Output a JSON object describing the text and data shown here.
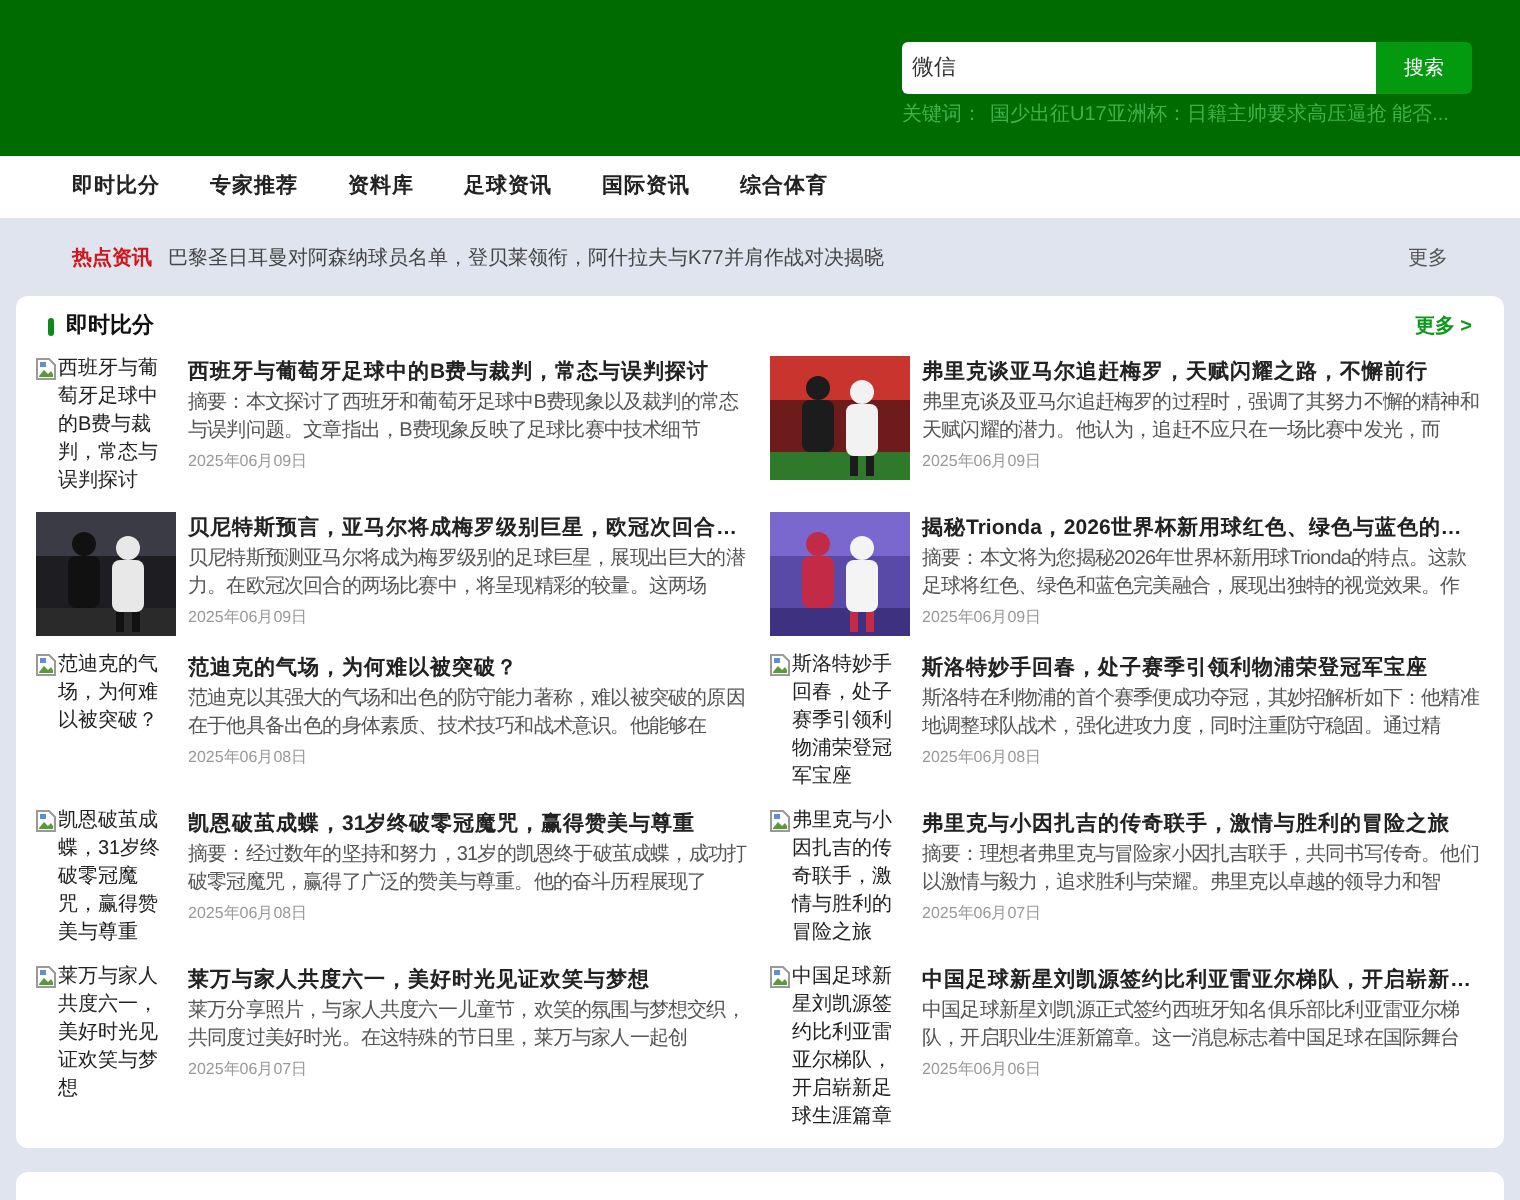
{
  "search": {
    "value": "微信",
    "button": "搜索"
  },
  "keywords": {
    "label": "关键词：",
    "text": "国少出征U17亚洲杯：日籍主帅要求高压逼抢  能否..."
  },
  "nav": [
    "即时比分",
    "专家推荐",
    "资料库",
    "足球资讯",
    "国际资讯",
    "综合体育"
  ],
  "hot_news": {
    "label": "热点资讯",
    "headline": "巴黎圣日耳曼对阿森纳球员名单，登贝莱领衔，阿什拉夫与K77并肩作战对决揭晓",
    "more": "更多"
  },
  "section": {
    "title": "即时比分",
    "more": "更多 >",
    "articles": [
      {
        "kind": "broken",
        "image_alt": "西班牙与葡萄牙足球中的B费与裁判，常态与误判探讨",
        "title": "西班牙与葡萄牙足球中的B费与裁判，常态与误判探讨",
        "summary": "摘要：本文探讨了西班牙和葡萄牙足球中B费现象以及裁判的常态与误判问题。文章指出，B费现象反映了足球比赛中技术细节",
        "date": "2025年06月09日"
      },
      {
        "title": "弗里克谈亚马尔追赶梅罗，天赋闪耀之路，不懈前行",
        "summary": "弗里克谈及亚马尔追赶梅罗的过程时，强调了其努力不懈的精神和天赋闪耀的潜力。他认为，追赶不应只在一场比赛中发光，而",
        "date": "2025年06月09日"
      },
      {
        "title": "贝尼特斯预言，亚马尔将成梅罗级别巨星，欧冠次回合…",
        "summary": "贝尼特斯预测亚马尔将成为梅罗级别的足球巨星，展现出巨大的潜力。在欧冠次回合的两场比赛中，将呈现精彩的较量。这两场",
        "date": "2025年06月09日"
      },
      {
        "title": "揭秘Trionda，2026世界杯新用球红色、绿色与蓝色的…",
        "summary": "摘要：本文将为您揭秘2026年世界杯新用球Trionda的特点。这款足球将红色、绿色和蓝色完美融合，展现出独特的视觉效果。作",
        "date": "2025年06月09日"
      },
      {
        "kind": "broken",
        "image_alt": "范迪克的气场，为何难以被突破？",
        "title": "范迪克的气场，为何难以被突破？",
        "summary": "范迪克以其强大的气场和出色的防守能力著称，难以被突破的原因在于他具备出色的身体素质、技术技巧和战术意识。他能够在",
        "date": "2025年06月08日"
      },
      {
        "kind": "broken",
        "image_alt": "斯洛特妙手回春，处子赛季引领利物浦荣登冠军宝座",
        "title": "斯洛特妙手回春，处子赛季引领利物浦荣登冠军宝座",
        "summary": "斯洛特在利物浦的首个赛季便成功夺冠，其妙招解析如下：他精准地调整球队战术，强化进攻力度，同时注重防守稳固。通过精",
        "date": "2025年06月08日"
      },
      {
        "kind": "broken",
        "image_alt": "凯恩破茧成蝶，31岁终破零冠魔咒，赢得赞美与尊重",
        "title": "凯恩破茧成蝶，31岁终破零冠魔咒，赢得赞美与尊重",
        "summary": "摘要：经过数年的坚持和努力，31岁的凯恩终于破茧成蝶，成功打破零冠魔咒，赢得了广泛的赞美与尊重。他的奋斗历程展现了",
        "date": "2025年06月08日"
      },
      {
        "kind": "broken",
        "image_alt": "弗里克与小因扎吉的传奇联手，激情与胜利的冒险之旅",
        "title": "弗里克与小因扎吉的传奇联手，激情与胜利的冒险之旅",
        "summary": "摘要：理想者弗里克与冒险家小因扎吉联手，共同书写传奇。他们以激情与毅力，追求胜利与荣耀。弗里克以卓越的领导力和智",
        "date": "2025年06月07日"
      },
      {
        "kind": "broken",
        "image_alt": "莱万与家人共度六一，美好时光见证欢笑与梦想",
        "title": "莱万与家人共度六一，美好时光见证欢笑与梦想",
        "summary": "莱万分享照片，与家人共度六一儿童节，欢笑的氛围与梦想交织，共同度过美好时光。在这特殊的节日里，莱万与家人一起创",
        "date": "2025年06月07日"
      },
      {
        "kind": "broken",
        "image_alt": "中国足球新星刘凯源签约比利亚雷亚尔梯队，开启崭新足球生涯篇章",
        "title": "中国足球新星刘凯源签约比利亚雷亚尔梯队，开启崭新…",
        "summary": "中国足球新星刘凯源正式签约西班牙知名俱乐部比利亚雷亚尔梯队，开启职业生涯新篇章。这一消息标志着中国足球在国际舞台",
        "date": "2025年06月06日"
      }
    ]
  }
}
